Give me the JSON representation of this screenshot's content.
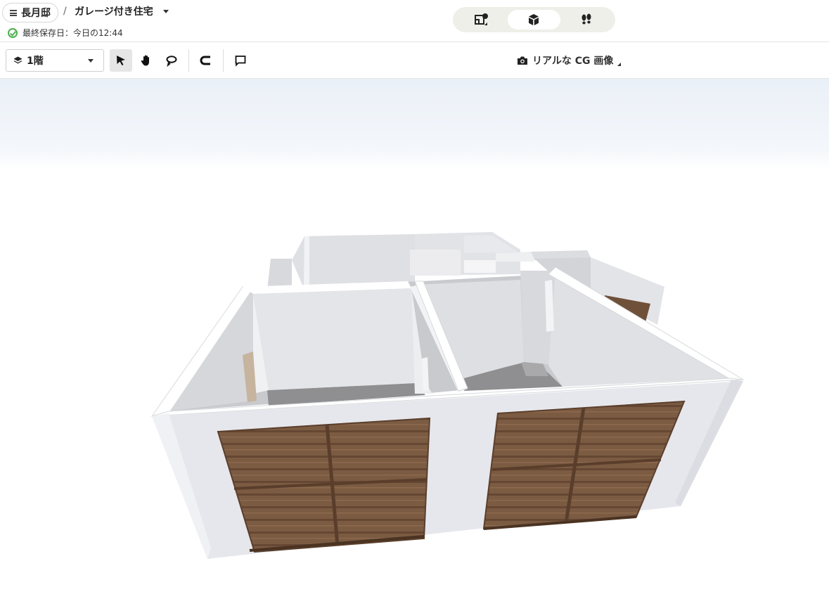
{
  "header": {
    "project_name": "長月邸",
    "separator": "/",
    "plan_name": "ガレージ付き住宅",
    "save_status": "最終保存日：今日の12:44",
    "view_modes": [
      {
        "name": "floorplan-2d-icon",
        "active": false
      },
      {
        "name": "view-3d-box-icon",
        "active": true
      },
      {
        "name": "walkthrough-footprints-icon",
        "active": false
      }
    ]
  },
  "toolbar": {
    "floor_label": "1階",
    "render_label": "リアルな CG 画像"
  },
  "colors": {
    "accent_check": "#4cae4c",
    "wall": "#e9eaee",
    "wood": "#7a5a41",
    "floor": "#9a9a9a"
  }
}
